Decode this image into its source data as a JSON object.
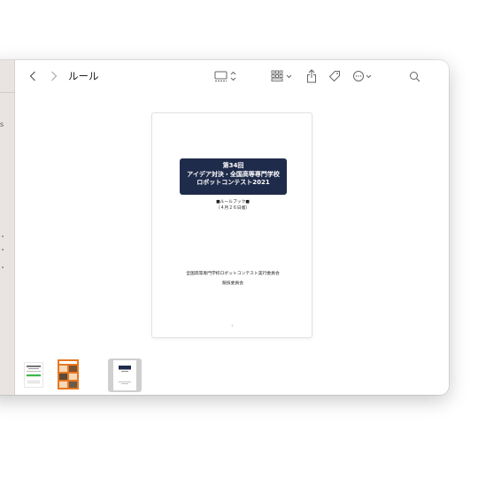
{
  "window": {
    "title": "ルール"
  },
  "sidebar": {
    "fragment_1": "s"
  },
  "toolbar": {
    "icons": [
      "chevron-left",
      "chevron-right",
      "view-mode",
      "group-by",
      "share",
      "tag",
      "more",
      "search"
    ]
  },
  "document": {
    "title_lines": [
      "第34回",
      "アイデア対決・全国高等専門学校",
      "ロボットコンテスト2021"
    ],
    "subtitle": "■ルールブック■",
    "edition": "（４月２６日版）",
    "org_line1": "全国高等専門学校ロボットコンテスト実行委員会",
    "org_line2": "競技委員会",
    "page_number": "1"
  },
  "colors": {
    "title_box": "#1f2b4a",
    "sidebar_bg": "#e9e4e2",
    "thumb_orange": "#e87722"
  }
}
